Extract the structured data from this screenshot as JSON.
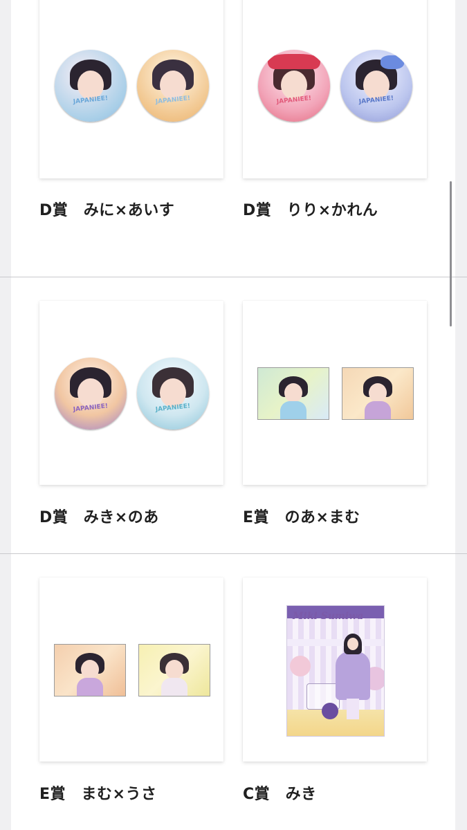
{
  "items": [
    {
      "label": "D賞　みに×あいす"
    },
    {
      "label": "D賞　りり×かれん"
    },
    {
      "label": "D賞　みき×のあ"
    },
    {
      "label": "E賞　のあ×まむ"
    },
    {
      "label": "E賞　まむ×うさ"
    },
    {
      "label": "C賞　みき"
    }
  ],
  "badge_logo_text": "JAPANIEE!",
  "acrylic_stand_text": "Miki Sumiwa",
  "colors": {
    "page_background": "#ffffff",
    "outer_background": "#f0f0f2",
    "divider": "#c9c9cc",
    "label_text": "#202020",
    "scrollbar": "#8e8e93"
  }
}
